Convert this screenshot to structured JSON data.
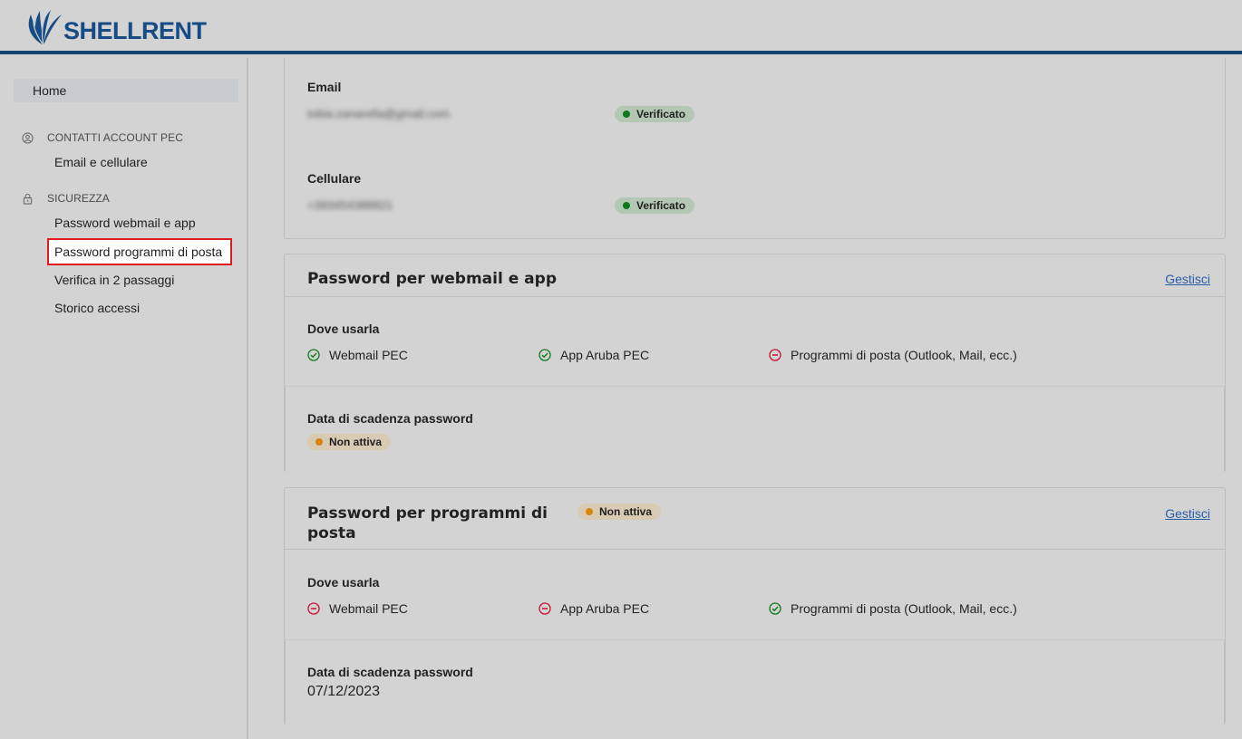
{
  "brand": {
    "name": "SHELLRENT",
    "color": "#174b86"
  },
  "sidebar": {
    "home_label": "Home",
    "sections": [
      {
        "title": "CONTATTI ACCOUNT PEC",
        "icon": "user-circle-icon",
        "items": [
          "Email e cellulare"
        ]
      },
      {
        "title": "SICUREZZA",
        "icon": "lock-icon",
        "items": [
          "Password webmail e app",
          "Password programmi di posta",
          "Verifica in 2 passaggi",
          "Storico accessi"
        ]
      }
    ],
    "active_item": "Password programmi di posta"
  },
  "contacts": {
    "email_label": "Email",
    "email_value": "tobia.zanarella@gmail.com",
    "email_status": "Verificato",
    "phone_label": "Cellulare",
    "phone_value": "+393454388821",
    "phone_status": "Verificato"
  },
  "webmail_password": {
    "title": "Password per webmail e app",
    "manage_label": "Gestisci",
    "where_label": "Dove usarla",
    "features": [
      {
        "label": "Webmail PEC",
        "allowed": true
      },
      {
        "label": "App Aruba PEC",
        "allowed": true
      },
      {
        "label": "Programmi di posta (Outlook, Mail, ecc.)",
        "allowed": false
      }
    ],
    "expiry_label": "Data di scadenza password",
    "expiry_status": "Non attiva"
  },
  "mail_programs_password": {
    "title_line1": "Password per programmi di",
    "title_line2": "posta",
    "status": "Non attiva",
    "manage_label": "Gestisci",
    "where_label": "Dove usarla",
    "features": [
      {
        "label": "Webmail PEC",
        "allowed": false
      },
      {
        "label": "App Aruba PEC",
        "allowed": false
      },
      {
        "label": "Programmi di posta (Outlook, Mail, ecc.)",
        "allowed": true
      }
    ],
    "expiry_label": "Data di scadenza password",
    "expiry_value": "07/12/2023"
  },
  "colors": {
    "accent": "#13446f",
    "ok": "#0e7a1e",
    "error": "#c8102e",
    "warn": "#d5870d",
    "link": "#2a5ea8"
  }
}
